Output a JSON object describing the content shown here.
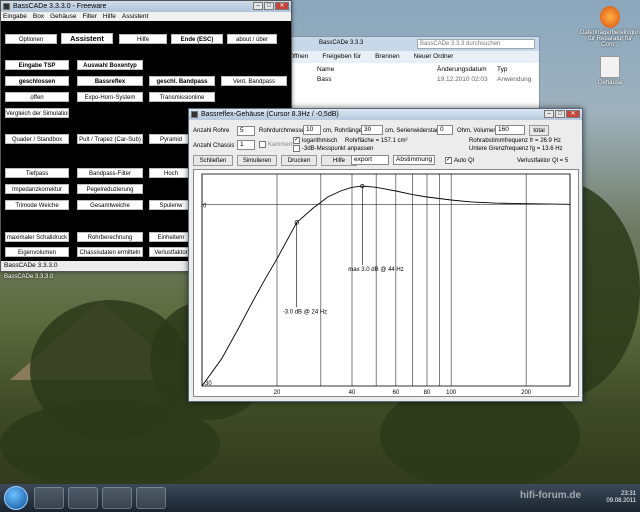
{
  "main_window": {
    "title": "BassCADe 3.3.3.0 - Freeware",
    "menu": [
      "Eingabe",
      "Box",
      "Gehäuse",
      "Filter",
      "Hilfe",
      "Assistent"
    ],
    "buttons": {
      "optionen": "Optionen",
      "assistent": "Assistent",
      "hilfe": "Hilfe",
      "ende": "Ende (ESC)",
      "about": "about / über",
      "eingabe_tsp": "Eingabe TSP",
      "auswahl_boxentyp": "Auswahl Boxentyp",
      "geschlossen": "geschlossen",
      "bassreflex": "Bassreflex",
      "geschl_bandpass": "geschl. Bandpass",
      "vent_bandpass": "Vent. Bandpass",
      "offen": "offen",
      "expo_horn": "Expo-Horn-System",
      "transmissionline": "Transmissionline",
      "vergleich": "Vergleich der Simulation",
      "quader": "Quader / Standbox",
      "pult": "Pult / Trapez (Car-Sub)",
      "pyramide": "Pyramid",
      "tiefpass": "Tiefpass",
      "bandpass_filter": "Bandpass-Filter",
      "hochpass": "Hoch",
      "impedanz": "Impedanzkorrektur",
      "pegel": "Pegelreduzierung",
      "trimode": "Trimode Weiche",
      "gesamtweiche": "Gesamtweiche",
      "spulenw": "Spulenw",
      "max_schall": "maximaler Schalldruck",
      "rohrberechnung": "Rohrberechnung",
      "einheiten": "Einheitenr",
      "eigenvolumen": "Eigenvolumen",
      "chassisdaten": "Chassisdaten ermitteln",
      "verlust": "Verlustfaktor"
    },
    "status": "BassCADe 3.3.3.0"
  },
  "taskbar_label": "BassCADe 3.3.3.0",
  "explorer": {
    "path": "BassCADe 3.3.3",
    "search_placeholder": "BassCADe 3.3.3 durchsuchen",
    "toolbar": [
      "Öffnen",
      "Freigeben für",
      "Brennen",
      "Neuer Ordner"
    ],
    "columns": [
      "Name",
      "Änderungsdatum",
      "Typ"
    ],
    "row": {
      "name": "Bass",
      "date": "19.12.2010 02:03",
      "type": "Anwendung"
    }
  },
  "dialog": {
    "title": "Bassreflex-Gehäuse (Cursor 8.3Hz / -0,5dB)",
    "labels": {
      "anzahl_rohre": "Anzahl Rohre",
      "rohrdurchmesser": "Rohrdurchmesser",
      "cm_rohrlaenge": "cm, Rohrlänge",
      "cm_serienwiderstand": "cm, Serienwiderstand",
      "ohm_volumen": "Ohm, Volumen",
      "total": "total",
      "anzahl_chassis": "Anzahl Chassis",
      "kammern": "Kammern",
      "logarithmisch": "logarithmisch",
      "rohrflaeche": "Rohrfläche = 157.1 cm²",
      "messpunkt": "-3dB-Messpunkt anpassen",
      "resonanz": "Rohrabstimmfrequenz fr = 26.9 Hz",
      "grenzfrequenz": "Untere Grenzfrequenz fg = 13.6 Hz",
      "auto_ql": "Auto Ql",
      "verlustfaktor": "Verlustfaktor Ql = 5"
    },
    "values": {
      "anzahl_rohre": "5",
      "rohrdurchmesser": "10",
      "rohrlaenge": "30",
      "serienwiderstand": "0",
      "volumen": "160",
      "anzahl_chassis": "1",
      "export": "export",
      "abstimmung": "Abstimmung"
    },
    "buttons": {
      "schliessen": "Schließen",
      "simulieren": "Simulieren",
      "drucken": "Drucken",
      "hilfe": "Hilfe"
    }
  },
  "chart_data": {
    "type": "line",
    "x_ticks": [
      "20",
      "40",
      "60",
      "80",
      "100",
      "200"
    ],
    "y_ticks": [
      "-30",
      "0"
    ],
    "xlim": [
      10,
      300
    ],
    "ylim": [
      -30,
      5
    ],
    "x_scale": "log",
    "series": [
      {
        "x": [
          10,
          12,
          14,
          16,
          18,
          20,
          24,
          28,
          32,
          36,
          40,
          44,
          50,
          60,
          70,
          80,
          100,
          120,
          150,
          200,
          300
        ],
        "y": [
          -30,
          -25.5,
          -20.5,
          -16,
          -12.2,
          -9,
          -3,
          -0.6,
          1.2,
          2.2,
          2.8,
          3.0,
          2.8,
          2.2,
          1.6,
          1.2,
          0.7,
          0.4,
          0.2,
          0.1,
          0.0
        ]
      }
    ],
    "annotations": [
      {
        "text": "-3.0 dB @ 24 Hz",
        "x": 24,
        "y": -3
      },
      {
        "text": "max 3.0 dB @ 44 Hz",
        "x": 44,
        "y": 3
      }
    ],
    "grid": true
  },
  "desktop_icons": [
    "Datenträgerbereinigung\nfür Reparatur für Com...",
    "Gehäuse"
  ],
  "tray": {
    "time": "23:31",
    "date": "09.08.2011"
  },
  "watermark": "hifi-forum.de"
}
